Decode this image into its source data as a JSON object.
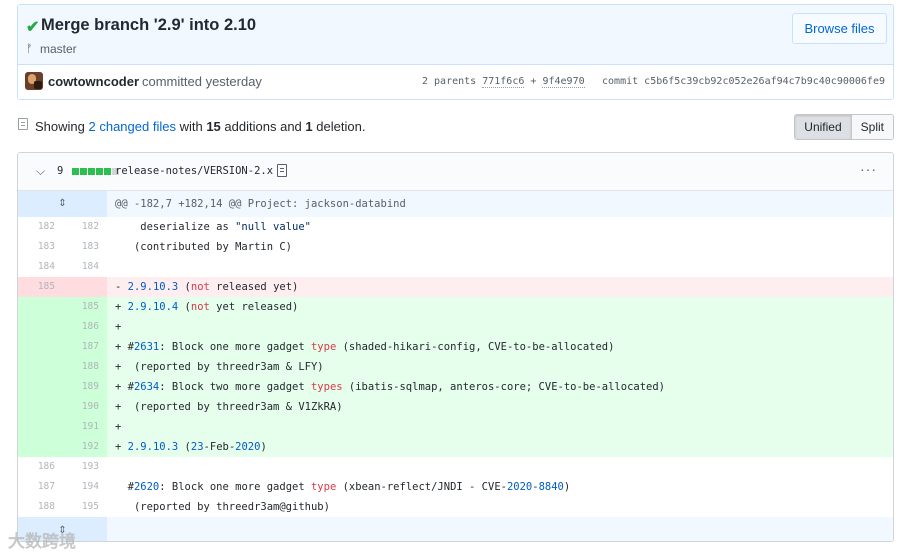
{
  "commit": {
    "title": "Merge branch '2.9' into 2.10",
    "branch": "master",
    "browse_label": "Browse files",
    "author": "cowtowncoder",
    "committed_text": "committed yesterday",
    "parents_label": "2 parents",
    "parent1": "771f6c6",
    "parent_sep": "+",
    "parent2": "9f4e970",
    "commit_label": "commit",
    "sha": "c5b6f5c39cb92c052e26af94c7b9c40c90006fe9"
  },
  "toc": {
    "showing": "Showing",
    "changed_files": "2 changed files",
    "with": "with",
    "additions_count": "15",
    "additions_word": "additions",
    "and": "and",
    "deletions_count": "1",
    "deletions_word": "deletion.",
    "unified_label": "Unified",
    "split_label": "Split"
  },
  "file": {
    "change_count": "9",
    "diffstat": [
      "add",
      "add",
      "add",
      "add",
      "add",
      "neutral"
    ],
    "name": "release-notes/VERSION-2.x",
    "hunk_header": "@@ -182,7 +182,14 @@ Project: jackson-databind",
    "lines": [
      {
        "type": "ctx",
        "old": "182",
        "new": "182",
        "html": "    deserialize as <span class=\"str\">\"null value\"</span>"
      },
      {
        "type": "ctx",
        "old": "183",
        "new": "183",
        "html": "   (contributed by Martin C)"
      },
      {
        "type": "ctx",
        "old": "184",
        "new": "184",
        "html": ""
      },
      {
        "type": "del",
        "old": "185",
        "new": "",
        "html": "- <span class=\"bl\">2.9.10.3</span> (<span class=\"kw\">not</span> released yet)"
      },
      {
        "type": "add",
        "old": "",
        "new": "185",
        "html": "+ <span class=\"bl\">2.9.10.4</span> (<span class=\"kw\">not</span> yet released)"
      },
      {
        "type": "add",
        "old": "",
        "new": "186",
        "html": "+"
      },
      {
        "type": "add",
        "old": "",
        "new": "187",
        "html": "+ #<span class=\"bl\">2631</span>: Block one more gadget <span class=\"kw\">type</span> (shaded-hikari-config, CVE-to-be-allocated)"
      },
      {
        "type": "add",
        "old": "",
        "new": "188",
        "html": "+  (reported by threedr3am &amp; LFY)"
      },
      {
        "type": "add",
        "old": "",
        "new": "189",
        "html": "+ #<span class=\"bl\">2634</span>: Block two more gadget <span class=\"kw\">types</span> (ibatis-sqlmap, anteros-core; CVE-to-be-allocated)"
      },
      {
        "type": "add",
        "old": "",
        "new": "190",
        "html": "+  (reported by threedr3am &amp; V1ZkRA)"
      },
      {
        "type": "add",
        "old": "",
        "new": "191",
        "html": "+"
      },
      {
        "type": "add",
        "old": "",
        "new": "192",
        "html": "+ <span class=\"bl\">2.9.10.3</span> (<span class=\"bl\">23</span>-Feb-<span class=\"bl\">2020</span>)"
      },
      {
        "type": "ctx",
        "old": "186",
        "new": "193",
        "html": ""
      },
      {
        "type": "ctx",
        "old": "187",
        "new": "194",
        "html": "  #<span class=\"bl\">2620</span>: Block one more gadget <span class=\"kw\">type</span> (xbean-reflect/JNDI - CVE-<span class=\"bl\">2020</span>-<span class=\"bl\">8840</span>)"
      },
      {
        "type": "ctx",
        "old": "188",
        "new": "195",
        "html": "   (reported by threedr3am@github)"
      }
    ]
  },
  "watermark": "大数跨境",
  "icons": {
    "check": "check-icon",
    "branch": "git-branch-icon",
    "toc": "file-diff-icon",
    "chevron": "chevron-down-icon",
    "copy": "clippy-icon",
    "kebab": "kebab-horizontal-icon",
    "expand": "unfold-icon"
  },
  "colors": {
    "link": "#0366d6",
    "addition": "#e6ffed",
    "deletion": "#ffeef0",
    "success": "#28a745"
  }
}
